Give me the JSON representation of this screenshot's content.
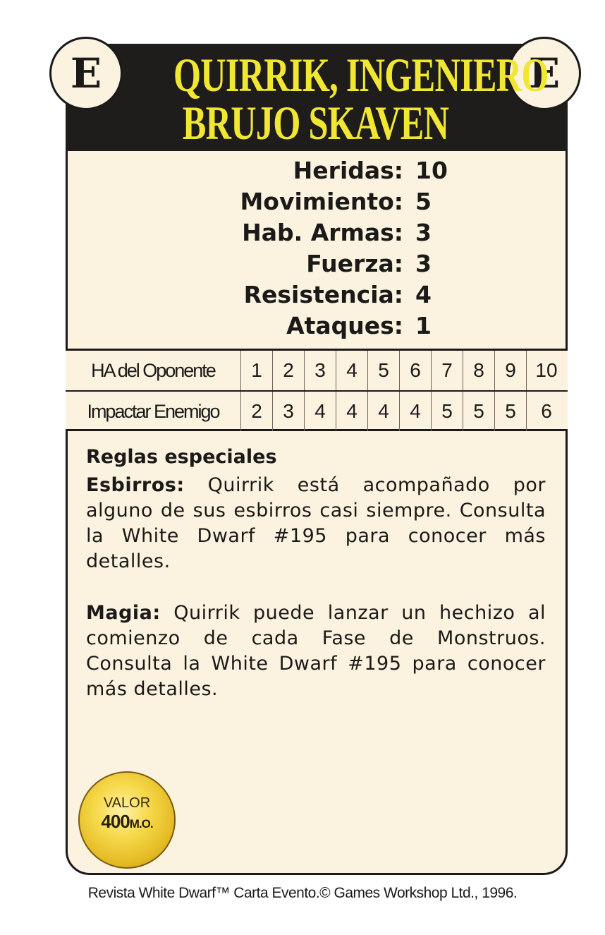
{
  "card": {
    "corner_letter": "E",
    "title_line1": "QUIRRIK, INGENIERO",
    "title_line2": "BRUJO SKAVEN"
  },
  "stats": [
    {
      "label": "Heridas:",
      "value": "10"
    },
    {
      "label": "Movimiento:",
      "value": "5"
    },
    {
      "label": "Hab. Armas:",
      "value": "3"
    },
    {
      "label": "Fuerza:",
      "value": "3"
    },
    {
      "label": "Resistencia:",
      "value": "4"
    },
    {
      "label": "Ataques:",
      "value": "1"
    }
  ],
  "to_hit_table": {
    "row1_label": "HA del Oponente",
    "row2_label": "Impactar Enemigo",
    "opponent_ws": [
      "1",
      "2",
      "3",
      "4",
      "5",
      "6",
      "7",
      "8",
      "9",
      "10"
    ],
    "to_hit": [
      "2",
      "3",
      "4",
      "4",
      "4",
      "4",
      "5",
      "5",
      "5",
      "6"
    ]
  },
  "rules": {
    "title": "Reglas especiales",
    "esbirros_label": "Esbirros:",
    "esbirros_text": " Quirrik está acompañado por alguno de sus esbirros casi siempre. Consulta la White Dwarf #195 para conocer más detalles.",
    "magia_label": "Magia:",
    "magia_text": " Quirrik puede lanzar un hechizo al comienzo de cada Fase de Monstruos. Consulta la White Dwarf #195 para conocer más detalles."
  },
  "value_coin": {
    "label": "VALOR",
    "amount": "400",
    "unit": "M.O."
  },
  "footer": "Revista White Dwarf™ Carta Evento.© Games Workshop Ltd., 1996."
}
